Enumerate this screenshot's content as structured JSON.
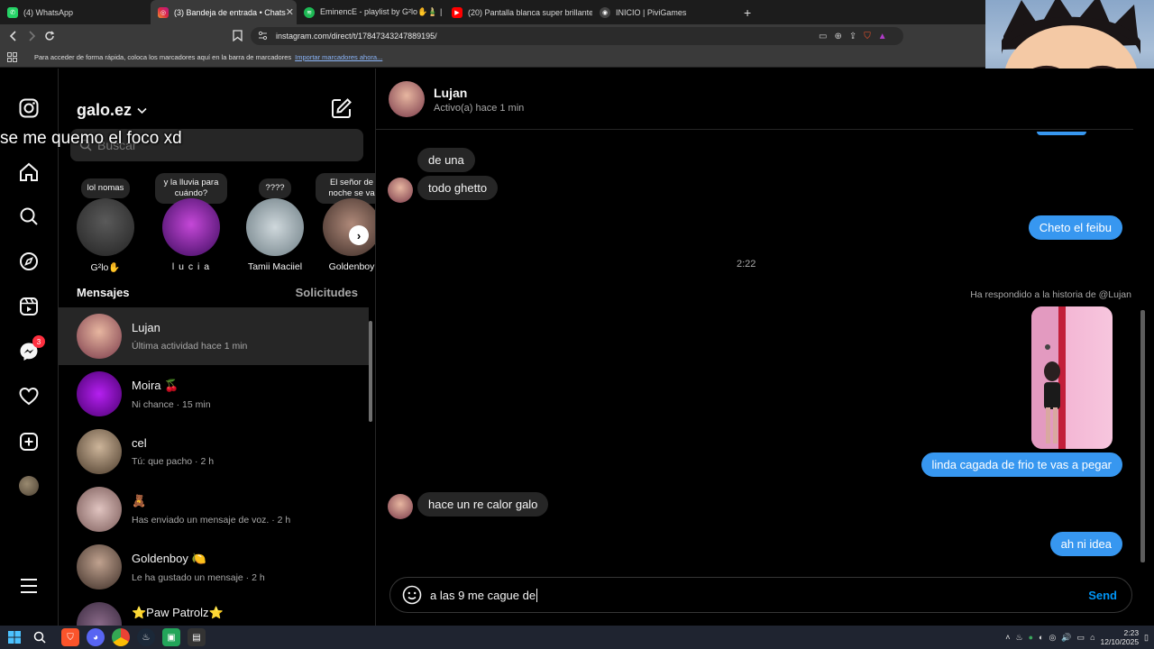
{
  "browser": {
    "tabs": [
      {
        "label": "(4) WhatsApp",
        "active": false
      },
      {
        "label": "(3) Bandeja de entrada • Chats",
        "active": true
      },
      {
        "label": "EminencE - playlist by G²lo✋🎍 | S",
        "active": false
      },
      {
        "label": "(20) Pantalla blanca super brillante -",
        "active": false
      },
      {
        "label": "INICIO | PiviGames",
        "active": false
      }
    ],
    "url": "instagram.com/direct/t/17847343247889195/",
    "bookmarks_text": "Para acceder de forma rápida, coloca los marcadores aquí en la barra de marcadores",
    "bookmarks_link": "Importar marcadores ahora..."
  },
  "rail": {
    "notification_count": "3"
  },
  "inbox": {
    "username": "galo.ez",
    "search_placeholder": "Buscar",
    "overlay_text": "se me quemo el foco xd",
    "notes": [
      {
        "bubble": "lol nomas",
        "name": "G²lo✋"
      },
      {
        "bubble": "y la lluvia para cuándo?",
        "name": "l u c i a"
      },
      {
        "bubble": "????",
        "name": "Tamii Maciiel"
      },
      {
        "bubble": "El señor de noche se va",
        "name": "Goldenboy"
      }
    ],
    "messages_label": "Mensajes",
    "requests_label": "Solicitudes",
    "conversations": [
      {
        "name": "Lujan",
        "sub": "Última actividad hace 1 min",
        "active": true
      },
      {
        "name": "Moira 🍒",
        "sub": "Ni chance · 15 min",
        "active": false
      },
      {
        "name": "cel",
        "sub": "Tú: que pacho · 2 h",
        "active": false
      },
      {
        "name": "🧸",
        "sub": "Has enviado un mensaje de voz. · 2 h",
        "active": false
      },
      {
        "name": "Goldenboy 🍋",
        "sub": "Le ha gustado un mensaje · 2 h",
        "active": false
      },
      {
        "name": "⭐Paw Patrolz⭐",
        "sub": "",
        "active": false
      }
    ]
  },
  "chat": {
    "name": "Lujan",
    "status": "Activo(a) hace 1 min",
    "messages": [
      {
        "text": "de una",
        "dir": "in"
      },
      {
        "text": "todo ghetto",
        "dir": "in"
      },
      {
        "text": "Cheto el feibu",
        "dir": "out"
      },
      {
        "text": "linda cagada de frio te vas a pegar",
        "dir": "out"
      },
      {
        "text": "hace un re calor galo",
        "dir": "in"
      },
      {
        "text": "ah ni idea",
        "dir": "out"
      }
    ],
    "timestamp": "2:22",
    "reply_label": "Ha respondido a la historia de @Lujan",
    "composer_value": "a las 9 me cague de",
    "send_label": "Send"
  },
  "taskbar": {
    "time": "2:23",
    "date": "12/10/2025"
  },
  "colors": {
    "accent_blue": "#3797f0",
    "send_blue": "#0095f6",
    "badge_red": "#ff3040"
  }
}
